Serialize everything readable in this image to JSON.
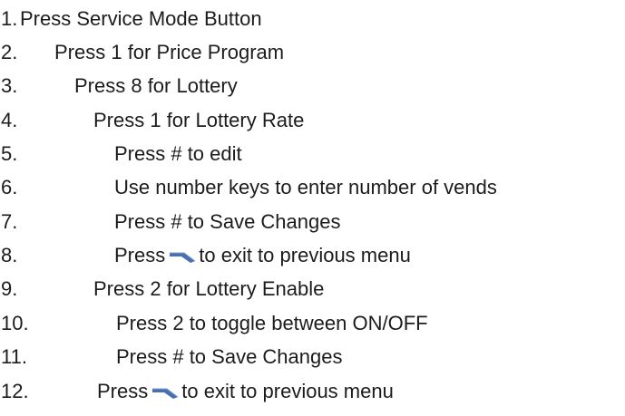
{
  "steps": [
    {
      "number": "1.",
      "text": "Press Service Mode Button"
    },
    {
      "number": "2.",
      "text": "Press 1 for Price Program"
    },
    {
      "number": "3.",
      "text": "Press 8 for Lottery"
    },
    {
      "number": "4.",
      "text": "Press 1 for Lottery Rate"
    },
    {
      "number": "5.",
      "text": "Press # to edit"
    },
    {
      "number": "6.",
      "text": "Use number keys to enter number of vends"
    },
    {
      "number": "7.",
      "text": "Press # to Save Changes"
    },
    {
      "number": "8.",
      "text_before": "Press",
      "text_after": "to exit to previous menu"
    },
    {
      "number": "9.",
      "text": "Press 2 for Lottery Enable"
    },
    {
      "number": "10.",
      "text": "Press 2 to toggle between ON/OFF"
    },
    {
      "number": "11.",
      "text": "Press # to Save Changes"
    },
    {
      "number": "12.",
      "text_before": "Press",
      "text_after": "to exit to previous menu"
    }
  ],
  "icons": {
    "back_key": "back-arrow-icon",
    "back_key_color": "#4a6fb0"
  }
}
